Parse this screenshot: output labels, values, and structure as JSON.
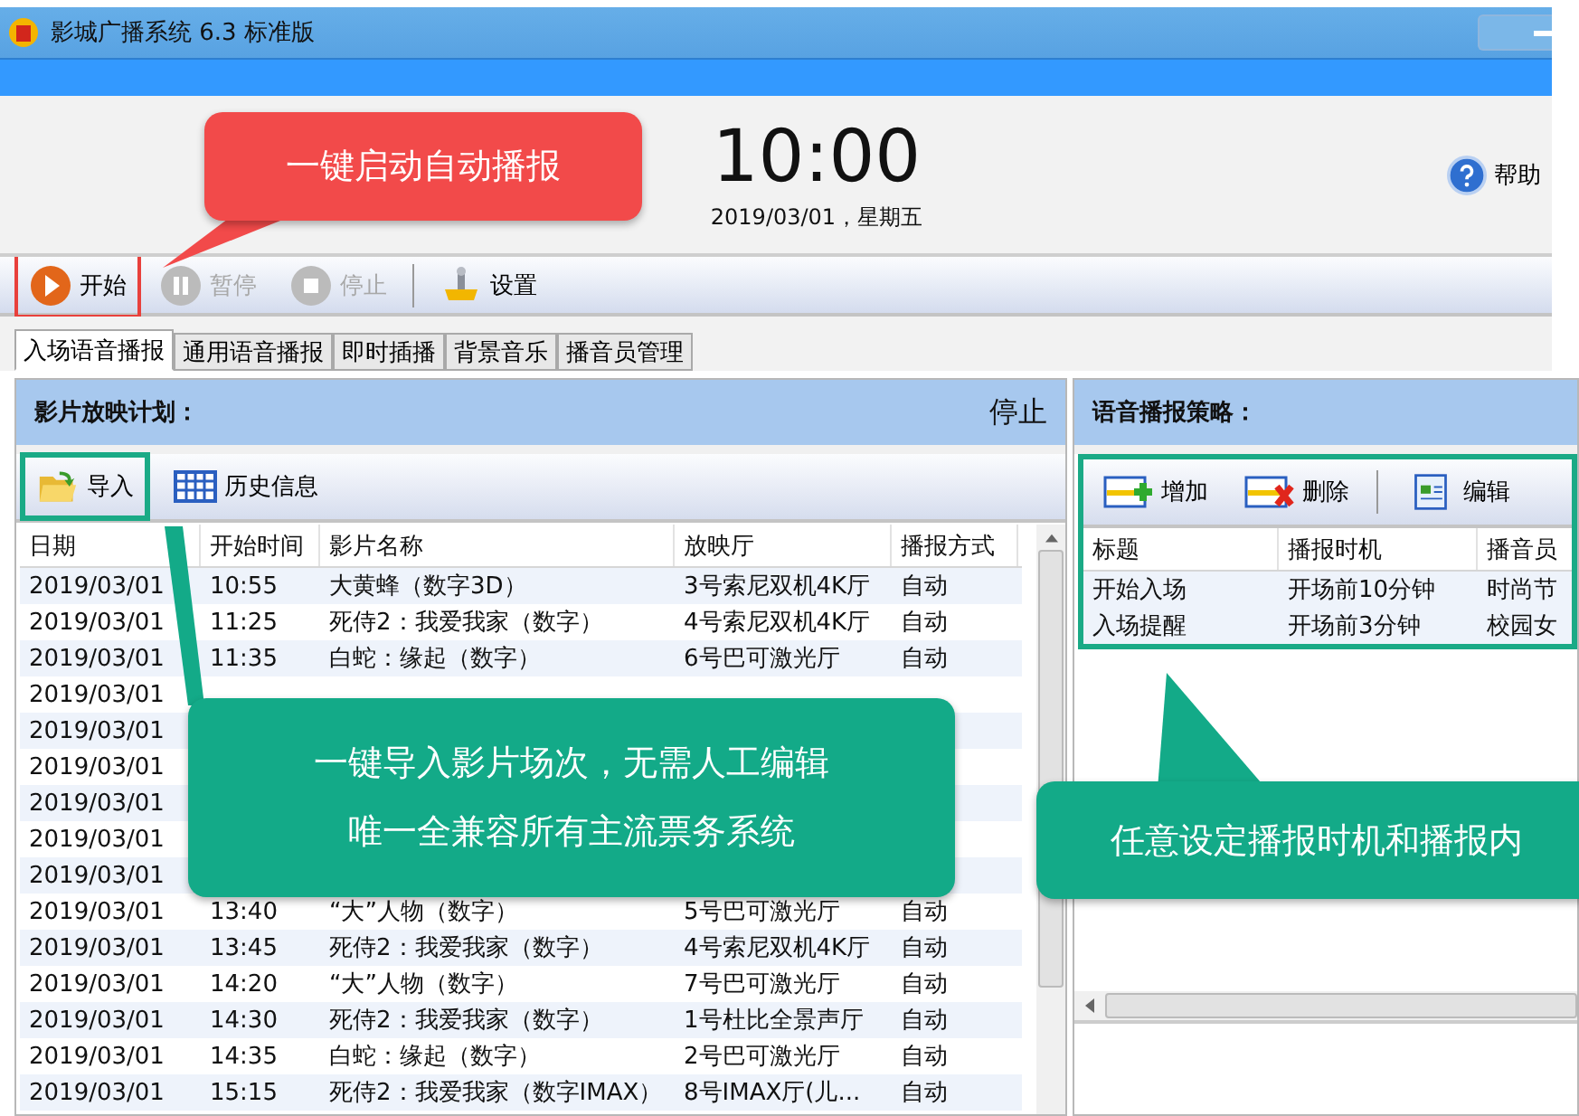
{
  "window": {
    "title": "影城广播系统 6.3 标准版"
  },
  "clock": {
    "time": "10:00",
    "date": "2019/03/01，星期五"
  },
  "help": {
    "label": "帮助"
  },
  "toolbar": [
    {
      "label": "开始",
      "disabled": false,
      "highlighted": true
    },
    {
      "label": "暂停",
      "disabled": true,
      "highlighted": false
    },
    {
      "label": "停止",
      "disabled": true,
      "highlighted": false
    },
    {
      "label": "设置",
      "disabled": false,
      "highlighted": false
    }
  ],
  "tabs": [
    {
      "label": "入场语音播报",
      "selected": true
    },
    {
      "label": "通用语音播报",
      "selected": false
    },
    {
      "label": "即时插播",
      "selected": false
    },
    {
      "label": "背景音乐",
      "selected": false
    },
    {
      "label": "播音员管理",
      "selected": false
    }
  ],
  "schedule": {
    "title": "影片放映计划：",
    "status": "停止",
    "actions": [
      {
        "label": "导入",
        "highlighted": true
      },
      {
        "label": "历史信息",
        "highlighted": false
      }
    ],
    "columns": [
      "日期",
      "开始时间",
      "影片名称",
      "放映厅",
      "播报方式"
    ],
    "rows": [
      [
        "2019/03/01",
        "10:55",
        "大黄蜂（数字3D）",
        "3号索尼双机4K厅",
        "自动"
      ],
      [
        "2019/03/01",
        "11:25",
        "死侍2：我爱我家（数字）",
        "4号索尼双机4K厅",
        "自动"
      ],
      [
        "2019/03/01",
        "11:35",
        "白蛇：缘起（数字）",
        "6号巴可激光厅",
        "自动"
      ],
      [
        "2019/03/01"
      ],
      [
        "2019/03/01"
      ],
      [
        "2019/03/01"
      ],
      [
        "2019/03/01"
      ],
      [
        "2019/03/01"
      ],
      [
        "2019/03/01"
      ],
      [
        "2019/03/01",
        "13:40",
        "“大”人物（数字）",
        "5号巴可激光厅",
        "自动"
      ],
      [
        "2019/03/01",
        "13:45",
        "死侍2：我爱我家（数字）",
        "4号索尼双机4K厅",
        "自动"
      ],
      [
        "2019/03/01",
        "14:20",
        "“大”人物（数字）",
        "7号巴可激光厅",
        "自动"
      ],
      [
        "2019/03/01",
        "14:30",
        "死侍2：我爱我家（数字）",
        "1号杜比全景声厅",
        "自动"
      ],
      [
        "2019/03/01",
        "14:35",
        "白蛇：缘起（数字）",
        "2号巴可激光厅",
        "自动"
      ],
      [
        "2019/03/01",
        "15:15",
        "死侍2：我爱我家（数字IMAX）",
        "8号IMAX厅(儿...",
        "自动"
      ]
    ]
  },
  "strategy": {
    "title": "语音播报策略：",
    "highlighted": true,
    "actions": [
      {
        "label": "增加"
      },
      {
        "label": "删除"
      },
      {
        "label": "编辑"
      }
    ],
    "columns": [
      "标题",
      "播报时机",
      "播音员"
    ],
    "rows": [
      [
        "开始入场",
        "开场前10分钟",
        "时尚节"
      ],
      [
        "入场提醒",
        "开场前3分钟",
        "校园女"
      ]
    ]
  },
  "callouts": [
    {
      "lines": [
        "一键启动自动播报"
      ],
      "color": "#f24a4a"
    },
    {
      "lines": [
        "一键导入影片场次，无需人工编辑",
        "唯一全兼容所有主流票务系统"
      ],
      "color": "#13aa88"
    },
    {
      "lines": [
        "任意设定播报时机和播报内"
      ],
      "color": "#13aa88"
    }
  ]
}
